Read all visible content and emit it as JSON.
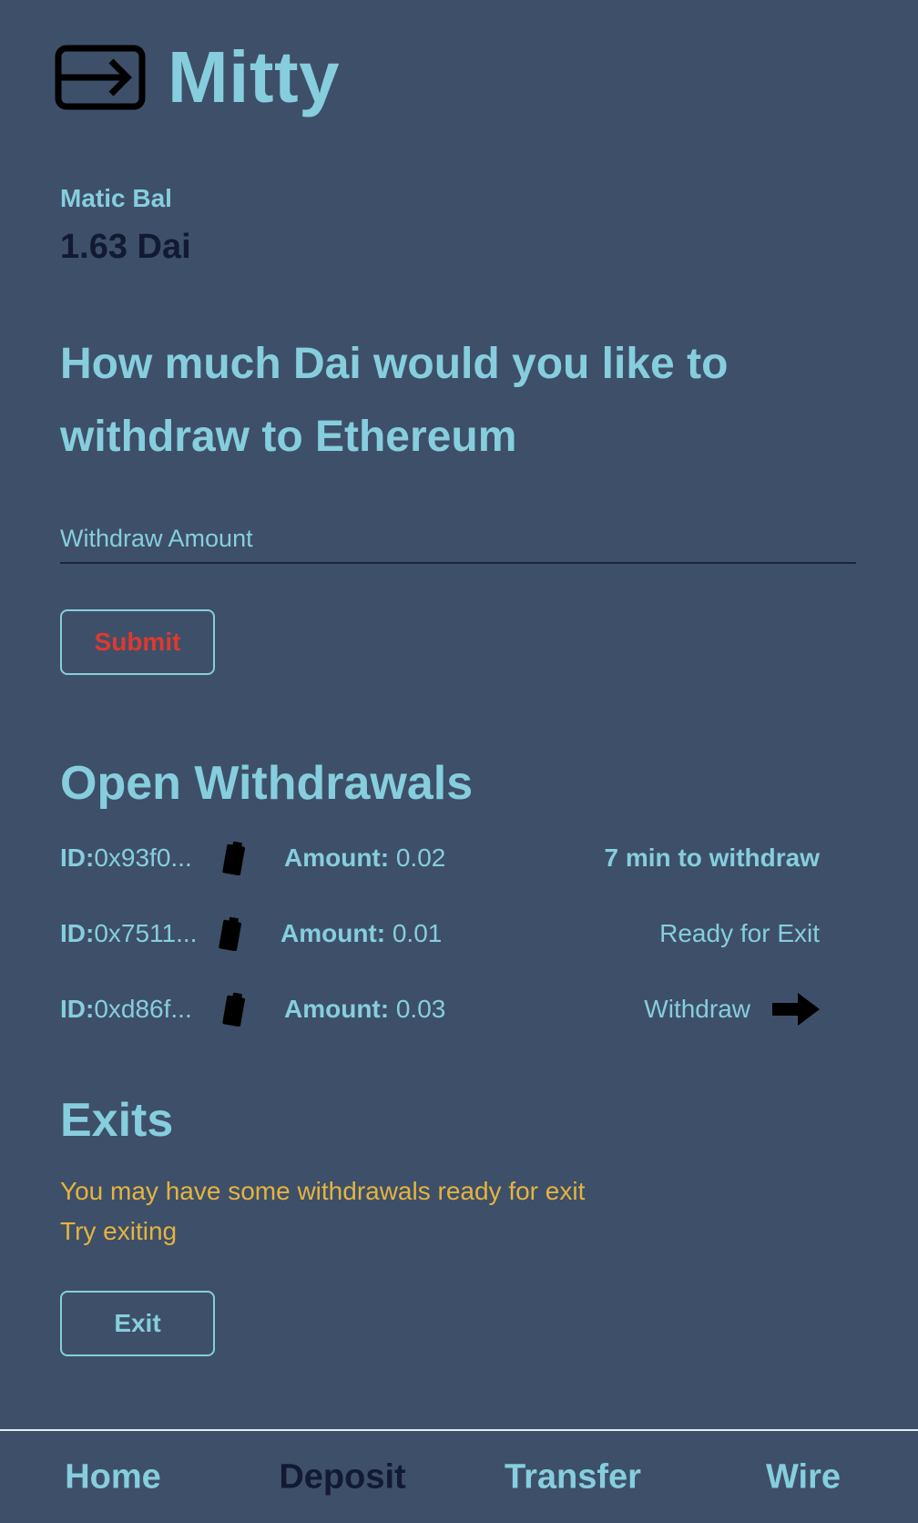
{
  "app": {
    "title": "Mitty",
    "logo_icon": "card-arrow-icon"
  },
  "balance": {
    "label": "Matic Bal",
    "value": "1.63 Dai"
  },
  "withdraw_form": {
    "question": "How much Dai would you like to withdraw to Ethereum",
    "amount_placeholder": "Withdraw Amount",
    "amount_value": "",
    "submit_label": "Submit"
  },
  "open_withdrawals": {
    "title": "Open Withdrawals",
    "id_label": "ID:",
    "amount_label": "Amount:",
    "copy_icon": "clipboard-icon",
    "rows": [
      {
        "id": "0x93f0...",
        "amount": "0.02",
        "status": "7 min to withdraw"
      },
      {
        "id": "0x7511...",
        "amount": "0.01",
        "status": "Ready for Exit"
      },
      {
        "id": "0xd86f...",
        "amount": "0.03",
        "action_label": "Withdraw",
        "action_icon": "arrow-right-icon"
      }
    ]
  },
  "exits": {
    "title": "Exits",
    "note_line1": "You may have some withdrawals ready for exit",
    "note_line2": "Try exiting",
    "exit_label": "Exit"
  },
  "nav": {
    "active": "Deposit",
    "items": [
      {
        "label": "Home"
      },
      {
        "label": "Deposit"
      },
      {
        "label": "Transfer"
      },
      {
        "label": "Wire"
      }
    ]
  },
  "colors": {
    "background": "#3e4f69",
    "accent": "#86cedd",
    "dark_text": "#121a33",
    "warning": "#e4b43e",
    "submit_text": "#dd3a2e"
  }
}
